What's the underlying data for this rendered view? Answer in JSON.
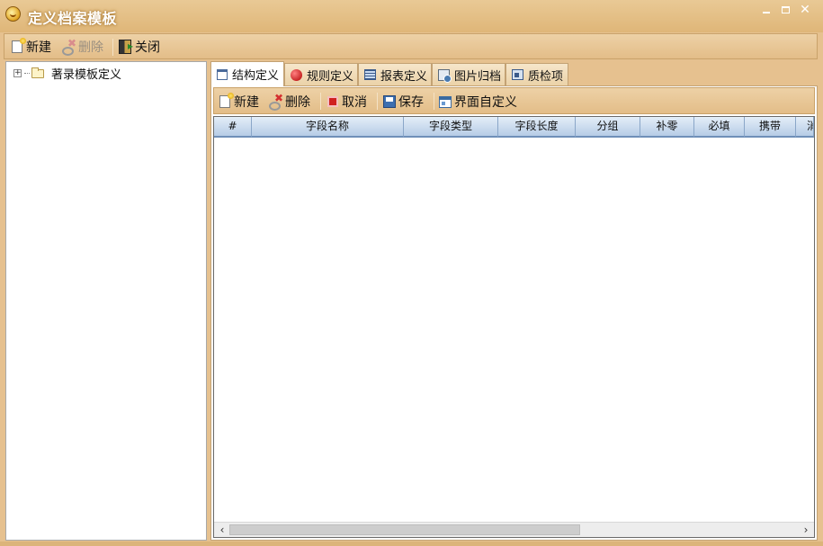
{
  "window": {
    "title": "定义档案模板",
    "controls": {
      "minimize": "—",
      "maximize": "□",
      "close": "✕"
    }
  },
  "toolbar": {
    "new_label": "新建",
    "delete_label": "删除",
    "close_label": "关闭"
  },
  "tree": {
    "expander": "+",
    "root_label": "著录模板定义"
  },
  "tabs": [
    {
      "label": "结构定义",
      "icon": "structure-icon",
      "active": true
    },
    {
      "label": "规则定义",
      "icon": "rule-icon",
      "active": false
    },
    {
      "label": "报表定义",
      "icon": "report-icon",
      "active": false
    },
    {
      "label": "图片归档",
      "icon": "image-archive-icon",
      "active": false
    },
    {
      "label": "质检项",
      "icon": "quality-check-icon",
      "active": false
    }
  ],
  "sub_toolbar": {
    "new_label": "新建",
    "delete_label": "删除",
    "cancel_label": "取消",
    "save_label": "保存",
    "ui_custom_label": "界面自定义"
  },
  "grid": {
    "columns": [
      "#",
      "字段名称",
      "字段类型",
      "字段长度",
      "分组",
      "补零",
      "必填",
      "携带",
      "消"
    ],
    "rows": []
  },
  "scrollbar": {
    "left_arrow": "‹",
    "right_arrow": "›"
  }
}
